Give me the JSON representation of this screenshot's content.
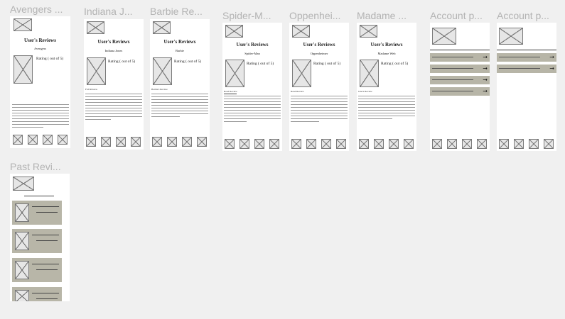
{
  "frames": {
    "avengers": {
      "label": "Avengers ..."
    },
    "indiana": {
      "label": "Indiana J..."
    },
    "barbie": {
      "label": "Barbie Re..."
    },
    "spiderman": {
      "label": "Spider-M..."
    },
    "oppenheimer": {
      "label": "Oppenhei..."
    },
    "madame": {
      "label": "Madame ..."
    },
    "account1": {
      "label": "Account p..."
    },
    "account2": {
      "label": "Account p..."
    },
    "past": {
      "label": "Past Revi..."
    }
  },
  "review_pages": {
    "avengers": {
      "heading": "User's Reviews",
      "movie": "Avengers",
      "rating": "Rating ( out of 5)",
      "author": ""
    },
    "indiana": {
      "heading": "User's Reviews",
      "movie": "Indiana Jones",
      "rating": "Rating ( out of 5)",
      "author": "Full Review"
    },
    "barbie": {
      "heading": "User's Reviews",
      "movie": "Barbie",
      "rating": "Rating ( out of 5)",
      "author": "Barbie's Review"
    },
    "spiderman": {
      "heading": "User's Reviews",
      "movie": "Spider-Man",
      "rating": "Rating ( out of 5)",
      "author": "Read Review"
    },
    "oppenheimer": {
      "heading": "User's Reviews",
      "movie": "Oppenheimer",
      "rating": "Rating ( out of 5)",
      "author": "Read Review"
    },
    "madame": {
      "heading": "User's Reviews",
      "movie": "Madame Web",
      "rating": "Rating ( out of 5)",
      "author": "Jane's Review"
    }
  },
  "colors": {
    "canvas": "#f0f0f0",
    "frame_bg": "#ffffff",
    "label": "#b3b3b3",
    "button_fill": "#b7b5a7",
    "placeholder_stroke": "#7a7a7a"
  }
}
